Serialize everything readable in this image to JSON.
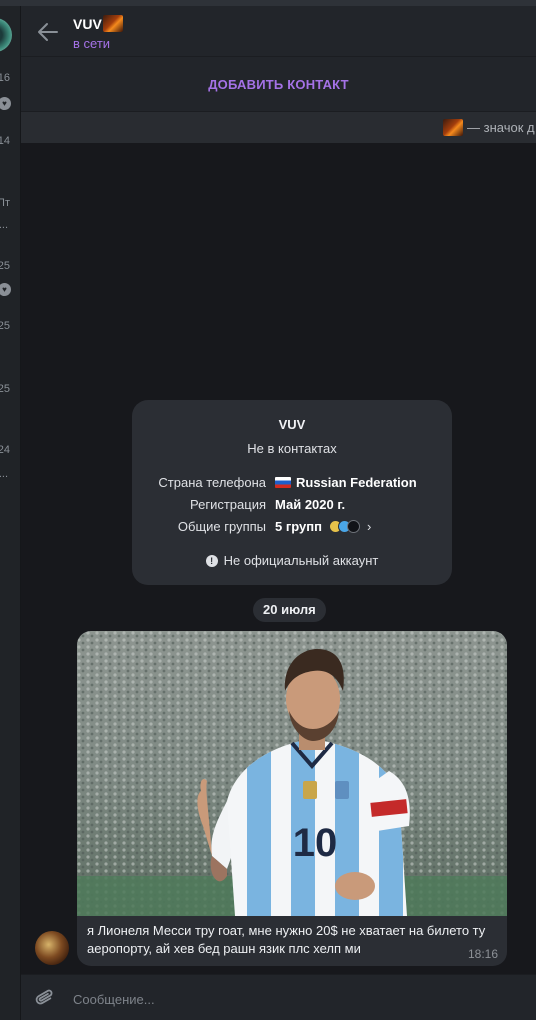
{
  "sidebar": {
    "times": [
      "16",
      "14",
      "Пт",
      "25",
      "25",
      "25",
      "24"
    ],
    "dots": [
      "...",
      "..."
    ]
  },
  "header": {
    "title": "VUV",
    "status": "в сети"
  },
  "add_contact": {
    "label": "ДОБАВИТЬ КОНТАКТ"
  },
  "bio": {
    "text": "— значок д"
  },
  "info_card": {
    "name": "VUV",
    "subtitle": "Не в контактах",
    "rows": [
      {
        "key": "Страна телефона",
        "value": "Russian Federation"
      },
      {
        "key": "Регистрация",
        "value": "Май 2020 г."
      },
      {
        "key": "Общие группы",
        "value": "5 групп"
      }
    ],
    "chevron": "›",
    "official": "Не официальный аккаунт"
  },
  "date_pill": "20 июля",
  "message": {
    "text": "я Лионеля Месси тру гоат, мне нужно 20$ не хватает на билето ту аеропорту, ай хев бед рашн язик плс хелп ми",
    "time": "18:16",
    "photo": {
      "jersey_number": "10"
    }
  },
  "composer": {
    "placeholder": "Сообщение..."
  },
  "colors": {
    "accent": "#a572e7",
    "background": "#17181c",
    "panel": "#22252a",
    "bubble": "#2b2e34"
  },
  "icons": [
    "back-arrow-icon",
    "flame-emoji-icon",
    "russia-flag-icon",
    "group-avatar-icons",
    "info-icon",
    "attach-paperclip-icon"
  ]
}
